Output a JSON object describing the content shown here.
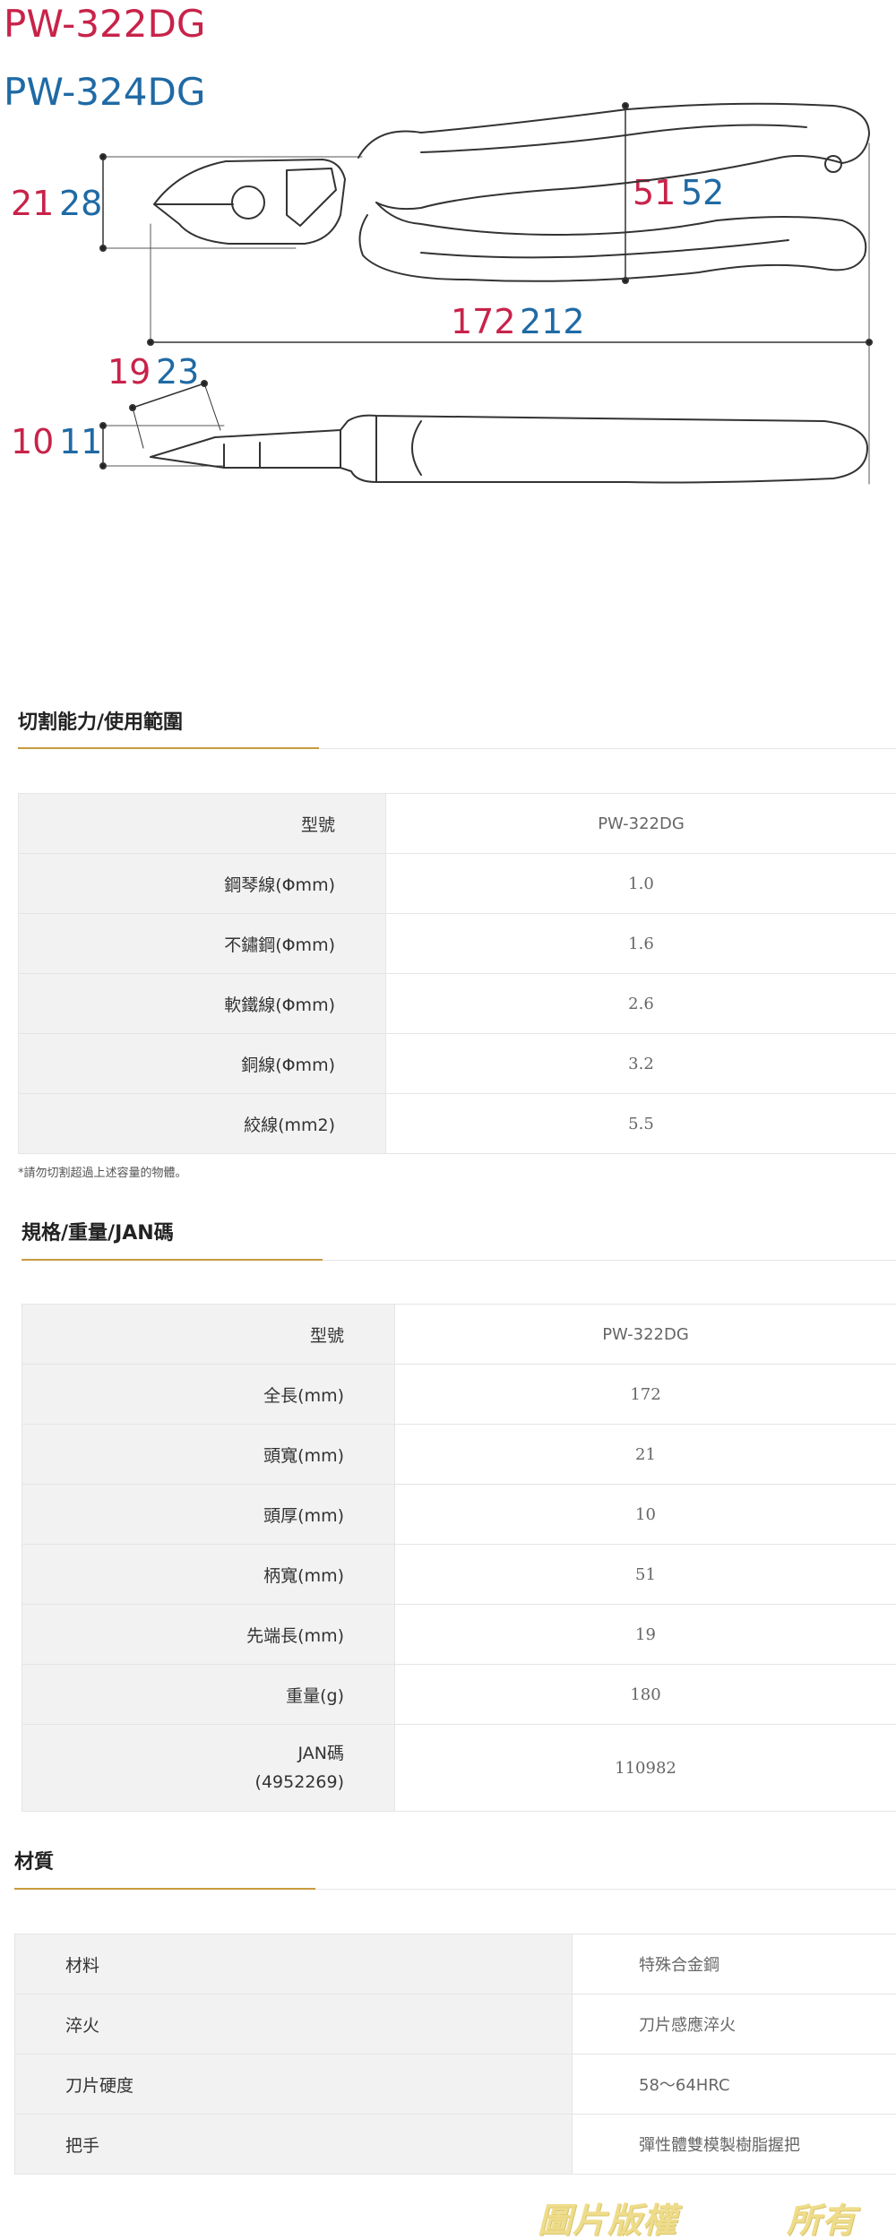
{
  "diagram": {
    "model_a": "PW-322DG",
    "model_b": "PW-324DG",
    "head_width_a": "21",
    "head_width_b": "28",
    "handle_width_a": "51",
    "handle_width_b": "52",
    "length_a": "172",
    "length_b": "212",
    "tip_length_a": "19",
    "tip_length_b": "23",
    "head_thick_a": "10",
    "head_thick_b": "11",
    "colors": {
      "model_a": "#c8234a",
      "model_b": "#1f6aa5"
    }
  },
  "cutting": {
    "title": "切割能力/使用範圍",
    "rows": [
      {
        "label": "型號",
        "value": "PW-322DG"
      },
      {
        "label": "鋼琴線(Φmm)",
        "value": "1.0"
      },
      {
        "label": "不鏽鋼(Φmm)",
        "value": "1.6"
      },
      {
        "label": "軟鐵線(Φmm)",
        "value": "2.6"
      },
      {
        "label": "銅線(Φmm)",
        "value": "3.2"
      },
      {
        "label": "絞線(mm2)",
        "value": "5.5"
      }
    ],
    "note": "*請勿切割超過上述容量的物體。"
  },
  "spec": {
    "title": "規格/重量/JAN碼",
    "rows": [
      {
        "label": "型號",
        "value": "PW-322DG"
      },
      {
        "label": "全長(mm)",
        "value": "172"
      },
      {
        "label": "頭寬(mm)",
        "value": "21"
      },
      {
        "label": "頭厚(mm)",
        "value": "10"
      },
      {
        "label": "柄寬(mm)",
        "value": "51"
      },
      {
        "label": "先端長(mm)",
        "value": "19"
      },
      {
        "label": "重量(g)",
        "value": "180"
      }
    ],
    "jan_label_1": "JAN碼",
    "jan_label_2": "(4952269)",
    "jan_value": "110982"
  },
  "material": {
    "title": "材質",
    "rows": [
      {
        "label": "材料",
        "value": "特殊合金鋼"
      },
      {
        "label": "淬火",
        "value": "刀片感應淬火"
      },
      {
        "label": "刀片硬度",
        "value": "58～64HRC"
      },
      {
        "label": "把手",
        "value": "彈性體雙模製樹脂握把"
      }
    ]
  },
  "watermark": {
    "text": "圖片版權",
    "small": "",
    "owner": "所有"
  }
}
